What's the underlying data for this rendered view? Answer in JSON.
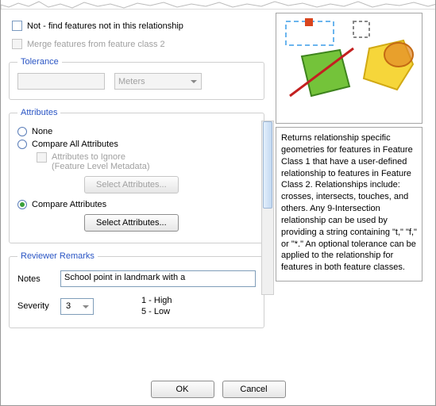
{
  "checkboxes": {
    "not_label": "Not - find features not in this relationship",
    "merge_label": "Merge features from feature class 2"
  },
  "tolerance": {
    "legend": "Tolerance",
    "units_selected": "Meters"
  },
  "attributes": {
    "legend": "Attributes",
    "none_label": "None",
    "compare_all_label": "Compare All Attributes",
    "ignore_label_l1": "Attributes to Ignore",
    "ignore_label_l2": "(Feature Level Metadata)",
    "select_btn": "Select Attributes...",
    "compare_label": "Compare Attributes",
    "selected": "compare"
  },
  "remarks": {
    "legend": "Reviewer Remarks",
    "notes_label": "Notes",
    "notes_value": "School point in landmark with a",
    "severity_label": "Severity",
    "severity_value": "3",
    "legend_high": "1 - High",
    "legend_low": "5 - Low"
  },
  "buttons": {
    "ok": "OK",
    "cancel": "Cancel"
  },
  "help_text": "Returns relationship specific geometries for features in Feature Class 1 that have a user-defined relationship to features in Feature Class 2.  Relationships include: crosses, intersects, touches, and others.  Any 9-Intersection relationship can be used by providing a string containing \"t,\" \"f,\" or \"*.\"  An optional tolerance can be applied to the relationship for features in both feature classes."
}
